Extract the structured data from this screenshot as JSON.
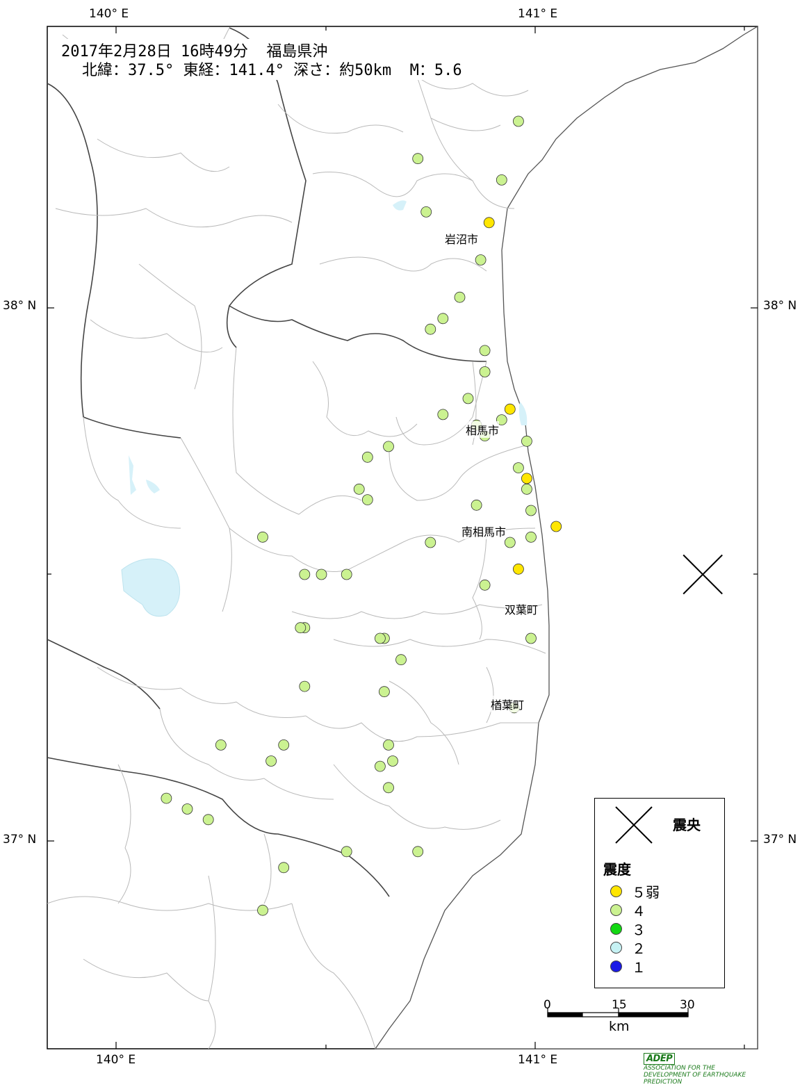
{
  "header": {
    "line1": "2017年2月28日 16時49分  福島県沖",
    "line2": "北緯：37.5° 東経：141.4° 深さ：約50km  M：5.6"
  },
  "axes": {
    "lon_labels": [
      "140° E",
      "141° E"
    ],
    "lat_labels": [
      "38° N",
      "37° N"
    ]
  },
  "cities": {
    "iwanuma": "岩沼市",
    "soma": "相馬市",
    "minamisoma": "南相馬市",
    "futaba": "双葉町",
    "naraha": "楢葉町"
  },
  "legend": {
    "epicenter_label": "震央",
    "intensity_title": "震度",
    "items": [
      {
        "label": "５弱",
        "color": "#ffe600"
      },
      {
        "label": "４",
        "color": "#cbf291"
      },
      {
        "label": "３",
        "color": "#12d812"
      },
      {
        "label": "２",
        "color": "#c6f2f4"
      },
      {
        "label": "１",
        "color": "#1a1ae6"
      }
    ]
  },
  "scale": {
    "ticks": [
      "0",
      "15",
      "30"
    ],
    "unit": "km"
  },
  "logo": {
    "text": "ADEP",
    "subtitle": "ASSOCIATION FOR THE DEVELOPMENT OF EARTHQUAKE PREDICTION"
  },
  "colors": {
    "5-": "#ffe600",
    "4": "#cbf291",
    "3": "#12d812",
    "2": "#c6f2f4",
    "1": "#1a1ae6",
    "water": "#d6f1f9"
  },
  "epicenter": {
    "lat": 37.5,
    "lon": 141.4
  },
  "stations": [
    {
      "lat": 37.51,
      "lon": 140.96,
      "int": "5-"
    },
    {
      "lat": 37.59,
      "lon": 141.05,
      "int": "5-"
    },
    {
      "lat": 37.68,
      "lon": 140.98,
      "int": "5-"
    },
    {
      "lat": 37.81,
      "lon": 140.94,
      "int": "5-"
    },
    {
      "lat": 38.16,
      "lon": 140.89,
      "int": "5-"
    },
    {
      "lat": 37.57,
      "lon": 140.99,
      "int": "4"
    },
    {
      "lat": 37.62,
      "lon": 140.99,
      "int": "4"
    },
    {
      "lat": 37.63,
      "lon": 140.86,
      "int": "4"
    },
    {
      "lat": 37.7,
      "lon": 140.96,
      "int": "4"
    },
    {
      "lat": 37.75,
      "lon": 140.98,
      "int": "4"
    },
    {
      "lat": 37.76,
      "lon": 140.88,
      "int": "4"
    },
    {
      "lat": 37.78,
      "lon": 140.86,
      "int": "4"
    },
    {
      "lat": 37.79,
      "lon": 140.92,
      "int": "4"
    },
    {
      "lat": 37.83,
      "lon": 140.84,
      "int": "4"
    },
    {
      "lat": 37.8,
      "lon": 140.78,
      "int": "4"
    },
    {
      "lat": 37.88,
      "lon": 140.88,
      "int": "4"
    },
    {
      "lat": 37.92,
      "lon": 140.88,
      "int": "4"
    },
    {
      "lat": 37.96,
      "lon": 140.75,
      "int": "4"
    },
    {
      "lat": 37.98,
      "lon": 140.78,
      "int": "4"
    },
    {
      "lat": 38.02,
      "lon": 140.82,
      "int": "4"
    },
    {
      "lat": 38.09,
      "lon": 140.87,
      "int": "4"
    },
    {
      "lat": 38.18,
      "lon": 140.74,
      "int": "4"
    },
    {
      "lat": 38.28,
      "lon": 140.72,
      "int": "4"
    },
    {
      "lat": 38.35,
      "lon": 140.96,
      "int": "4"
    },
    {
      "lat": 38.24,
      "lon": 140.92,
      "int": "4"
    },
    {
      "lat": 37.74,
      "lon": 140.65,
      "int": "4"
    },
    {
      "lat": 37.72,
      "lon": 140.6,
      "int": "4"
    },
    {
      "lat": 37.66,
      "lon": 140.58,
      "int": "4"
    },
    {
      "lat": 37.64,
      "lon": 140.6,
      "int": "4"
    },
    {
      "lat": 37.5,
      "lon": 140.55,
      "int": "4"
    },
    {
      "lat": 37.4,
      "lon": 140.45,
      "int": "4"
    },
    {
      "lat": 37.38,
      "lon": 140.64,
      "int": "4"
    },
    {
      "lat": 37.34,
      "lon": 140.68,
      "int": "4"
    },
    {
      "lat": 37.29,
      "lon": 140.45,
      "int": "4"
    },
    {
      "lat": 37.18,
      "lon": 140.65,
      "int": "4"
    },
    {
      "lat": 37.18,
      "lon": 140.4,
      "int": "4"
    },
    {
      "lat": 37.15,
      "lon": 140.37,
      "int": "4"
    },
    {
      "lat": 37.18,
      "lon": 140.25,
      "int": "4"
    },
    {
      "lat": 36.98,
      "lon": 140.72,
      "int": "4"
    },
    {
      "lat": 36.98,
      "lon": 140.55,
      "int": "4"
    },
    {
      "lat": 36.95,
      "lon": 140.4,
      "int": "4"
    },
    {
      "lat": 36.87,
      "lon": 140.35,
      "int": "4"
    },
    {
      "lat": 37.57,
      "lon": 140.35,
      "int": "4"
    },
    {
      "lat": 37.5,
      "lon": 140.49,
      "int": "4"
    },
    {
      "lat": 37.5,
      "lon": 140.45,
      "int": "4"
    },
    {
      "lat": 37.4,
      "lon": 140.44,
      "int": "4"
    },
    {
      "lat": 37.38,
      "lon": 140.63,
      "int": "4"
    },
    {
      "lat": 37.28,
      "lon": 140.64,
      "int": "4"
    },
    {
      "lat": 37.15,
      "lon": 140.66,
      "int": "4"
    },
    {
      "lat": 37.14,
      "lon": 140.63,
      "int": "4"
    },
    {
      "lat": 37.1,
      "lon": 140.65,
      "int": "4"
    },
    {
      "lat": 37.04,
      "lon": 140.22,
      "int": "4"
    },
    {
      "lat": 37.06,
      "lon": 140.17,
      "int": "4"
    },
    {
      "lat": 37.08,
      "lon": 140.12,
      "int": "4"
    },
    {
      "lat": 37.48,
      "lon": 140.88,
      "int": "4"
    },
    {
      "lat": 37.56,
      "lon": 140.94,
      "int": "4"
    },
    {
      "lat": 37.25,
      "lon": 140.95,
      "int": "4"
    },
    {
      "lat": 37.38,
      "lon": 140.99,
      "int": "4"
    },
    {
      "lat": 37.56,
      "lon": 140.75,
      "int": "4"
    },
    {
      "lat": 37.66,
      "lon": 140.98,
      "int": "4"
    }
  ]
}
